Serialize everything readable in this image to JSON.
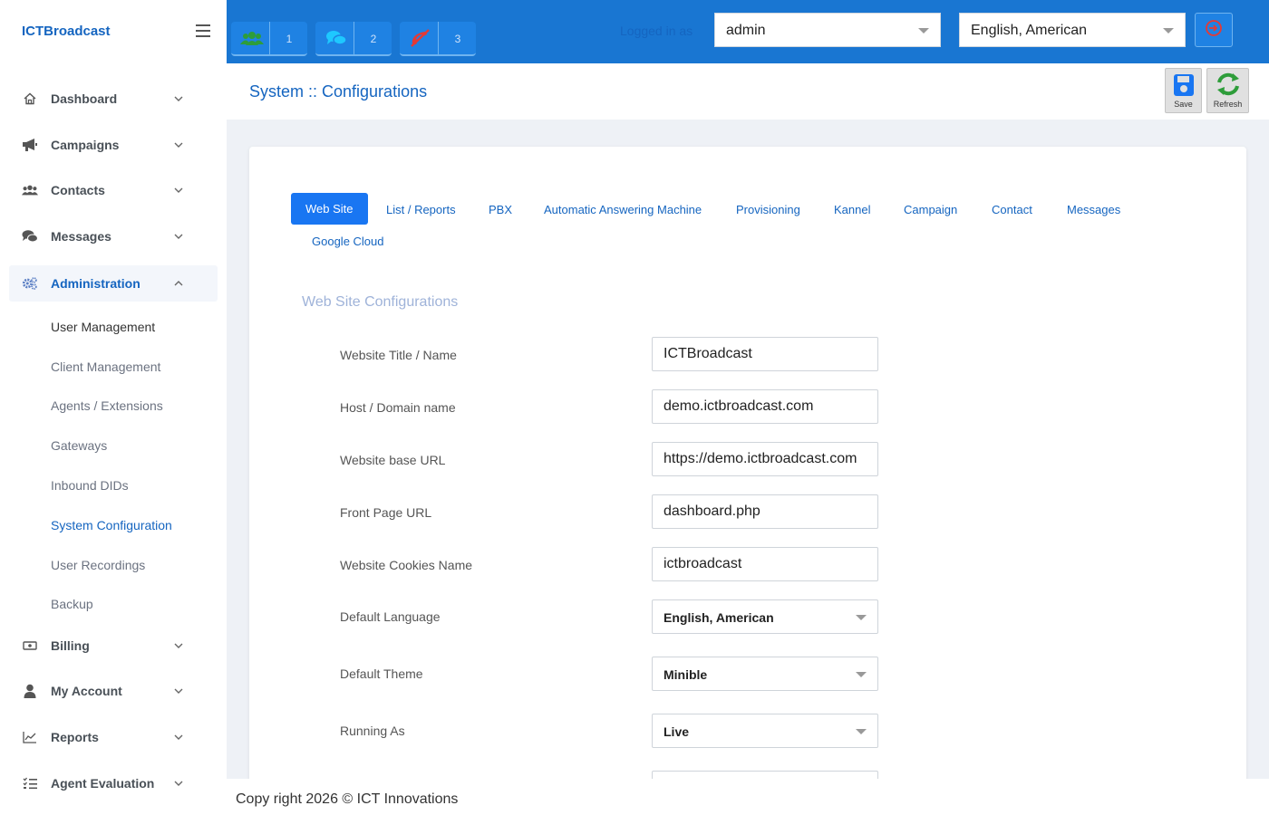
{
  "brand": "ICTBroadcast",
  "sidebar": {
    "items": [
      {
        "label": "Dashboard",
        "icon": "home-icon"
      },
      {
        "label": "Campaigns",
        "icon": "megaphone-icon"
      },
      {
        "label": "Contacts",
        "icon": "users-icon"
      },
      {
        "label": "Messages",
        "icon": "comments-icon"
      },
      {
        "label": "Administration",
        "icon": "cogs-icon",
        "expanded": true
      },
      {
        "label": "Billing",
        "icon": "money-icon"
      },
      {
        "label": "My Account",
        "icon": "user-icon"
      },
      {
        "label": "Reports",
        "icon": "chart-line-icon"
      },
      {
        "label": "Agent Evaluation",
        "icon": "checklist-icon"
      }
    ],
    "admin_sub": [
      "User Management",
      "Client Management",
      "Agents / Extensions",
      "Gateways",
      "Inbound DIDs",
      "System Configuration",
      "User Recordings",
      "Backup"
    ]
  },
  "topbar": {
    "badges": [
      {
        "icon": "users-badge-icon",
        "count": "1",
        "color": "#2e9d3a"
      },
      {
        "icon": "chat-badge-icon",
        "count": "2",
        "color": "#1ec8ff"
      },
      {
        "icon": "phone-slash-badge-icon",
        "count": "3",
        "color": "#e53935"
      }
    ],
    "logged_in_label": "Logged in as",
    "user_select": "admin",
    "language_select": "English, American"
  },
  "page": {
    "title": "System :: Configurations",
    "save_label": "Save",
    "refresh_label": "Refresh"
  },
  "tabs": [
    "Web Site",
    "List / Reports",
    "PBX",
    "Automatic Answering Machine",
    "Provisioning",
    "Kannel",
    "Campaign",
    "Contact",
    "Messages",
    "Google Cloud"
  ],
  "form": {
    "section_title": "Web Site Configurations",
    "fields": [
      {
        "label": "Website Title / Name",
        "value": "ICTBroadcast"
      },
      {
        "label": "Host / Domain name",
        "value": "demo.ictbroadcast.com"
      },
      {
        "label": "Website base URL",
        "value": "https://demo.ictbroadcast.com"
      },
      {
        "label": "Front Page URL",
        "value": "dashboard.php"
      },
      {
        "label": "Website Cookies Name",
        "value": "ictbroadcast"
      }
    ],
    "selects": [
      {
        "label": "Default Language",
        "value": "English, American"
      },
      {
        "label": "Default Theme",
        "value": "Minible"
      },
      {
        "label": "Running As",
        "value": "Live"
      }
    ]
  },
  "footer": "Copy right 2026 © ICT Innovations"
}
